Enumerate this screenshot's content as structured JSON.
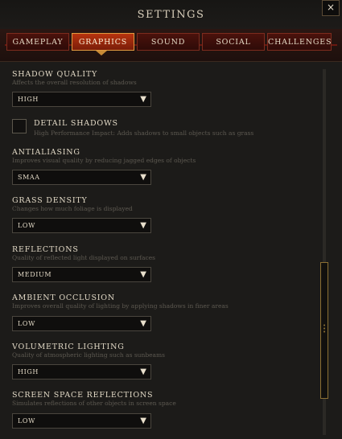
{
  "header": {
    "title": "SETTINGS",
    "close_glyph": "×"
  },
  "tabs": [
    {
      "label": "GAMEPLAY"
    },
    {
      "label": "GRAPHICS",
      "active": true
    },
    {
      "label": "SOUND"
    },
    {
      "label": "SOCIAL"
    },
    {
      "label": "CHALLENGES"
    }
  ],
  "settings": {
    "shadow_quality": {
      "title": "SHADOW QUALITY",
      "desc": "Affects the overall resolution of shadows",
      "value": "HIGH"
    },
    "detail_shadows": {
      "title": "DETAIL SHADOWS",
      "desc": "High Performance Impact: Adds shadows to small objects such as grass",
      "checked": false
    },
    "antialiasing": {
      "title": "ANTIALIASING",
      "desc": "Improves visual quality by reducing jagged edges of objects",
      "value": "SMAA"
    },
    "grass_density": {
      "title": "GRASS DENSITY",
      "desc": "Changes how much foliage is displayed",
      "value": "LOW"
    },
    "reflections": {
      "title": "REFLECTIONS",
      "desc": "Quality of reflected light displayed on surfaces",
      "value": "MEDIUM"
    },
    "ambient_occlusion": {
      "title": "AMBIENT OCCLUSION",
      "desc": "Improves overall quality of lighting by applying shadows in finer areas",
      "value": "LOW"
    },
    "volumetric_lighting": {
      "title": "VOLUMETRIC LIGHTING",
      "desc": "Quality of atmospheric lighting such as sunbeams",
      "value": "HIGH"
    },
    "screen_space_reflections": {
      "title": "SCREEN SPACE REFLECTIONS",
      "desc": "Simulates reflections of other objects in screen space",
      "value": "LOW"
    }
  },
  "dropdown_arrow": "▼",
  "icons": {
    "close": "close-icon",
    "dropdown": "chevron-down-icon",
    "checkbox": "checkbox-icon"
  },
  "colors": {
    "accent": "#c98c36",
    "active_tab": "#b8340f",
    "text": "#e2d9c6",
    "desc": "#5d5951"
  }
}
